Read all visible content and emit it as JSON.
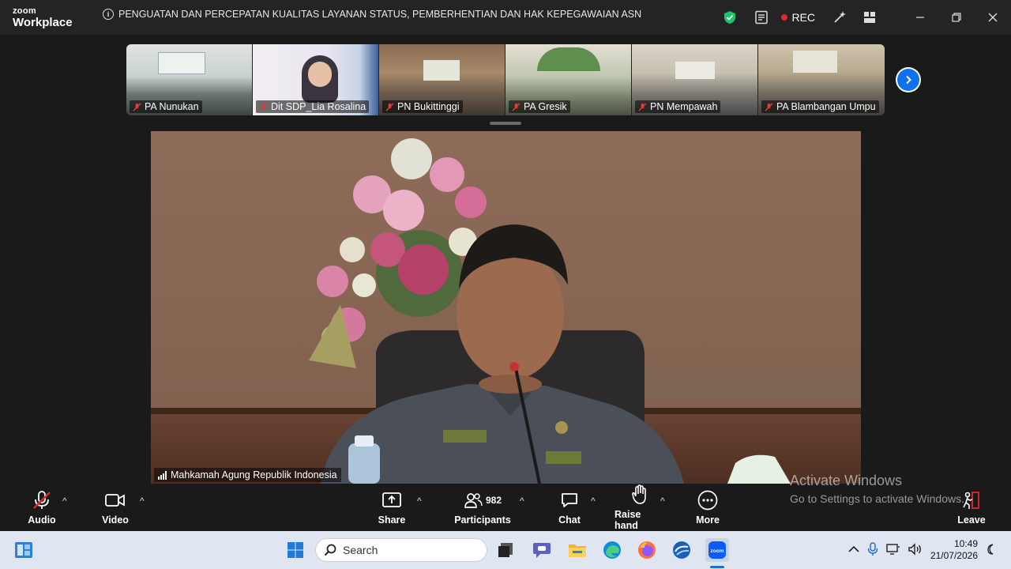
{
  "app": {
    "logo_line1": "zoom",
    "logo_line2": "Workplace",
    "meeting_title": "PENGUATAN DAN PERCEPATAN KUALITAS LAYANAN STATUS, PEMBERHENTIAN DAN HAK KEPEGAWAIAN ASN",
    "rec_label": "REC",
    "accent": "#0e72ed",
    "rec_color": "#e02a2a",
    "shield_color": "#1fc46a"
  },
  "participants_strip": [
    {
      "name": "PA Nunukan",
      "muted": true
    },
    {
      "name": "Dit SDP_Lia Rosalina",
      "muted": true
    },
    {
      "name": "PN Bukittinggi",
      "muted": true
    },
    {
      "name": "PA Gresik",
      "muted": true
    },
    {
      "name": "PN Mempawah",
      "muted": true
    },
    {
      "name": "PA Blambangan Umpu",
      "muted": true
    }
  ],
  "main_video": {
    "speaker_name": "Mahkamah Agung Republik Indonesia"
  },
  "watermark": {
    "line1": "Activate Windows",
    "line2": "Go to Settings to activate Windows."
  },
  "toolbar": {
    "audio": "Audio",
    "video": "Video",
    "share": "Share",
    "participants": "Participants",
    "participants_count": "982",
    "chat": "Chat",
    "raise_hand": "Raise hand",
    "more": "More",
    "leave": "Leave"
  },
  "taskbar": {
    "search_placeholder": "Search",
    "time": "10:49",
    "date": "21/07/2026"
  }
}
